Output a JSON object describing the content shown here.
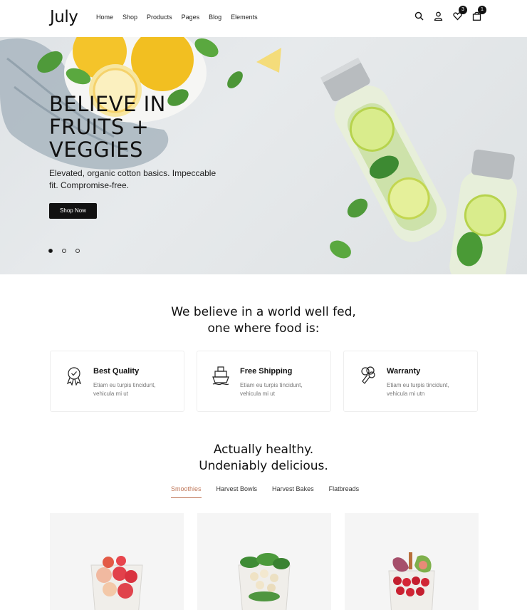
{
  "header": {
    "logo": "July",
    "nav": [
      "Home",
      "Shop",
      "Products",
      "Pages",
      "Blog",
      "Elements"
    ],
    "icons": [
      "search-icon",
      "user-icon",
      "heart-icon",
      "bag-icon"
    ],
    "wishlist_count": "3",
    "cart_count": "1"
  },
  "hero": {
    "title": "BELIEVE IN FRUITS + VEGGIES",
    "subtitle": "Elevated, organic cotton basics. Impeccable fit. Compromise-free.",
    "button": "Shop Now",
    "slides": 3,
    "active_slide": 1
  },
  "belief": {
    "title_line1": "We believe in a world well fed,",
    "title_line2": "one where food is:",
    "features": [
      {
        "title": "Best Quality",
        "desc": "Etiam eu turpis tincidunt, vehicula mi ut",
        "icon": "award-icon"
      },
      {
        "title": "Free Shipping",
        "desc": "Etiam eu turpis tincidunt, vehicula mi ut",
        "icon": "ship-icon"
      },
      {
        "title": "Warranty",
        "desc": "Etiam eu turpis tincidunt, vehicula mi utn",
        "icon": "broccoli-icon"
      }
    ]
  },
  "healthy": {
    "title_line1": "Actually healthy.",
    "title_line2": "Undeniably delicious.",
    "tabs": [
      "Smoothies",
      "Harvest Bowls",
      "Harvest Bakes",
      "Flatbreads"
    ],
    "active_tab": "Smoothies"
  },
  "colors": {
    "accent": "#c0785a",
    "dark": "#111111",
    "hero_bg": "#e3e6e8"
  }
}
